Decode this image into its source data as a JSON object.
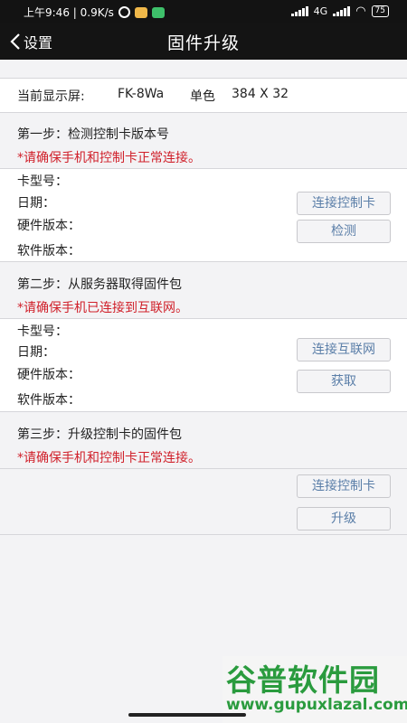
{
  "status_bar": {
    "time_speed": "上午9:46 | 0.9K/s",
    "network": "4G",
    "battery": "75"
  },
  "nav": {
    "back_label": "设置",
    "title": "固件升级"
  },
  "display": {
    "label": "当前显示屏:",
    "model": "FK-8Wa",
    "color": "单色",
    "resolution": "384 X 32"
  },
  "step1": {
    "title": "第一步：检测控制卡版本号",
    "warning": "*请确保手机和控制卡正常连接。",
    "fields": [
      "卡型号：",
      "日期：",
      "硬件版本：",
      "软件版本："
    ],
    "btn_connect": "连接控制卡",
    "btn_action": "检测"
  },
  "step2": {
    "title": "第二步：从服务器取得固件包",
    "warning": "*请确保手机已连接到互联网。",
    "fields": [
      "卡型号：",
      "日期：",
      "硬件版本：",
      "软件版本："
    ],
    "btn_connect": "连接互联网",
    "btn_action": "获取"
  },
  "step3": {
    "title": "第三步：升级控制卡的固件包",
    "warning": "*请确保手机和控制卡正常连接。",
    "btn_connect": "连接控制卡",
    "btn_action": "升级"
  },
  "watermark": {
    "name": "谷普软件园",
    "url": "www.gupuxlazal.com"
  }
}
